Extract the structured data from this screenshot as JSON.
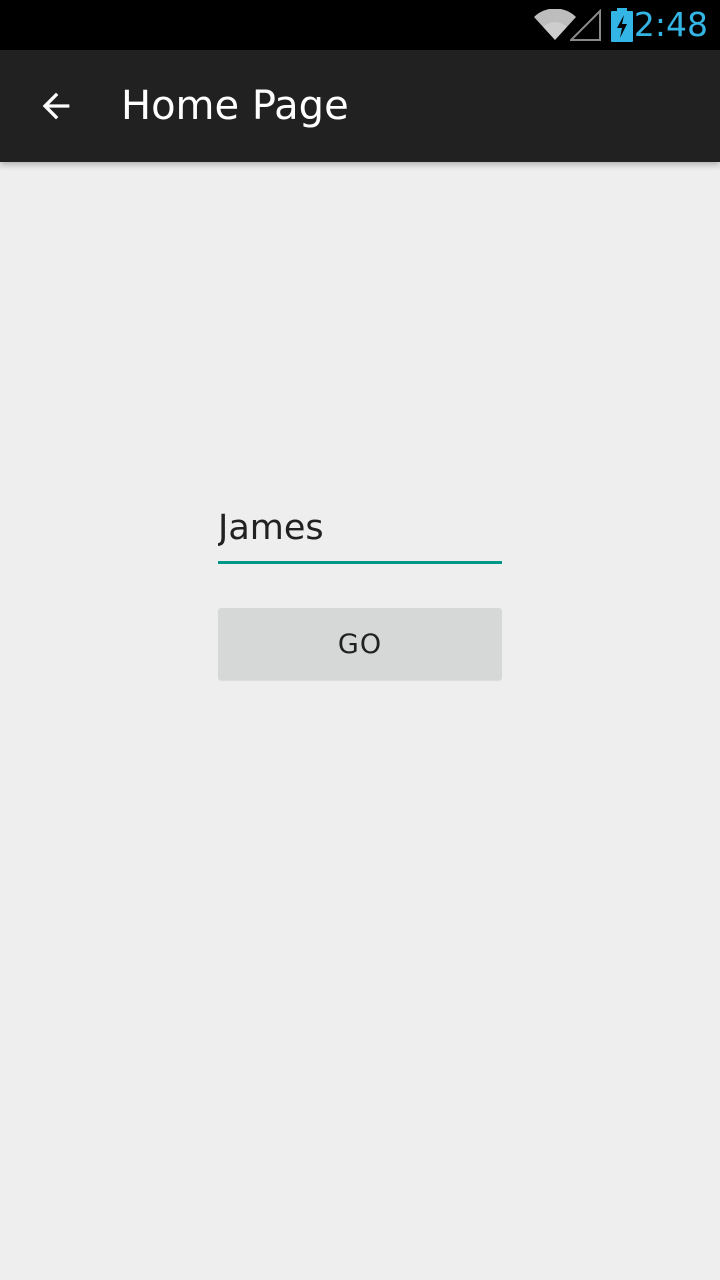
{
  "status_bar": {
    "time": "2:48",
    "wifi_icon": "wifi-icon",
    "signal_icon": "cell-signal-icon",
    "battery_icon": "battery-charging-icon",
    "clock_color": "#33b5e5"
  },
  "app_bar": {
    "back_icon": "arrow-back-icon",
    "title": "Home Page",
    "background": "#212121"
  },
  "form": {
    "name_value": "James",
    "name_placeholder": "",
    "go_label": "GO",
    "accent_color": "#009688"
  }
}
